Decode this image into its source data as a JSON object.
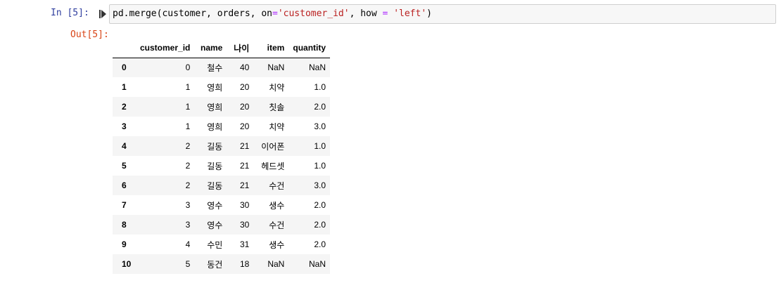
{
  "cell": {
    "in_prompt": "In [5]:",
    "out_prompt": "Out[5]:",
    "code": {
      "t1": "pd.merge(customer, orders, on",
      "t2": "=",
      "t3": "'customer_id'",
      "t4": ", how ",
      "t5": "=",
      "t6": " ",
      "t7": "'left'",
      "t8": ")"
    }
  },
  "table": {
    "headers": [
      "",
      "customer_id",
      "name",
      "나이",
      "item",
      "quantity"
    ],
    "rows": [
      {
        "index": "0",
        "customer_id": "0",
        "name": "철수",
        "age": "40",
        "item": "NaN",
        "quantity": "NaN"
      },
      {
        "index": "1",
        "customer_id": "1",
        "name": "영희",
        "age": "20",
        "item": "치약",
        "quantity": "1.0"
      },
      {
        "index": "2",
        "customer_id": "1",
        "name": "영희",
        "age": "20",
        "item": "칫솔",
        "quantity": "2.0"
      },
      {
        "index": "3",
        "customer_id": "1",
        "name": "영희",
        "age": "20",
        "item": "치약",
        "quantity": "3.0"
      },
      {
        "index": "4",
        "customer_id": "2",
        "name": "길동",
        "age": "21",
        "item": "이어폰",
        "quantity": "1.0"
      },
      {
        "index": "5",
        "customer_id": "2",
        "name": "길동",
        "age": "21",
        "item": "헤드셋",
        "quantity": "1.0"
      },
      {
        "index": "6",
        "customer_id": "2",
        "name": "길동",
        "age": "21",
        "item": "수건",
        "quantity": "3.0"
      },
      {
        "index": "7",
        "customer_id": "3",
        "name": "영수",
        "age": "30",
        "item": "생수",
        "quantity": "2.0"
      },
      {
        "index": "8",
        "customer_id": "3",
        "name": "영수",
        "age": "30",
        "item": "수건",
        "quantity": "2.0"
      },
      {
        "index": "9",
        "customer_id": "4",
        "name": "수민",
        "age": "31",
        "item": "생수",
        "quantity": "2.0"
      },
      {
        "index": "10",
        "customer_id": "5",
        "name": "동건",
        "age": "18",
        "item": "NaN",
        "quantity": "NaN"
      }
    ]
  },
  "colors": {
    "in_prompt": "#303f9f",
    "out_prompt": "#d84315",
    "string": "#ba2121",
    "operator": "#aa22ff",
    "striped_row": "#f5f5f5"
  },
  "icons": {
    "run": "run-cell-icon"
  }
}
